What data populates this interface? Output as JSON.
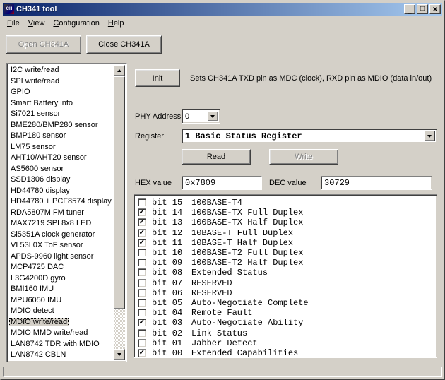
{
  "window": {
    "title": "CH341 tool"
  },
  "icons": {
    "app": "CH",
    "minimize": "_",
    "maximize": "□",
    "close": "×",
    "check": "✓"
  },
  "menu": {
    "items": [
      "File",
      "View",
      "Configuration",
      "Help"
    ]
  },
  "toolbar": {
    "open_button": "Open CH341A",
    "close_button": "Close CH341A"
  },
  "sidebar": {
    "items": [
      "I2C write/read",
      "SPI write/read",
      "GPIO",
      "Smart Battery info",
      "Si7021 sensor",
      "BME280/BMP280 sensor",
      "BMP180 sensor",
      "LM75 sensor",
      "AHT10/AHT20 sensor",
      "AS5600 sensor",
      "SSD1306 display",
      "HD44780 display",
      "HD44780 + PCF8574 display",
      "RDA5807M FM tuner",
      "MAX7219 SPI 8x8 LED",
      "Si5351A clock generator",
      "VL53L0X ToF sensor",
      "APDS-9960 light sensor",
      "MCP4725 DAC",
      "L3G4200D gyro",
      "BMI160 IMU",
      "MPU6050 IMU",
      "MDIO detect",
      "MDIO write/read",
      "MDIO MMD write/read",
      "LAN8742 TDR with MDIO",
      "LAN8742 CBLN"
    ],
    "selected_item": "MDIO write/read"
  },
  "mdio_panel": {
    "init_button": "Init",
    "init_description": "Sets CH341A TXD pin as MDC (clock), RXD pin as MDIO (data in/out)",
    "phy_address_label": "PHY Address",
    "phy_address_value": "0",
    "register_label": "Register",
    "register_value": "1 Basic Status Register",
    "read_button": "Read",
    "write_button": "Write",
    "hex_label": "HEX value",
    "hex_value": "0x7809",
    "dec_label": "DEC value",
    "dec_value": "30729"
  },
  "register_bits": [
    {
      "label": "bit 15",
      "description": "100BASE-T4",
      "checked": false
    },
    {
      "label": "bit 14",
      "description": "100BASE-TX Full Duplex",
      "checked": true
    },
    {
      "label": "bit 13",
      "description": "100BASE-TX Half Duplex",
      "checked": true
    },
    {
      "label": "bit 12",
      "description": "10BASE-T Full Duplex",
      "checked": true
    },
    {
      "label": "bit 11",
      "description": "10BASE-T Half Duplex",
      "checked": true
    },
    {
      "label": "bit 10",
      "description": "100BASE-T2 Full Duplex",
      "checked": false
    },
    {
      "label": "bit 09",
      "description": "100BASE-T2 Half Duplex",
      "checked": false
    },
    {
      "label": "bit 08",
      "description": "Extended Status",
      "checked": false
    },
    {
      "label": "bit 07",
      "description": "RESERVED",
      "checked": false
    },
    {
      "label": "bit 06",
      "description": "RESERVED",
      "checked": false
    },
    {
      "label": "bit 05",
      "description": "Auto-Negotiate Complete",
      "checked": false
    },
    {
      "label": "bit 04",
      "description": "Remote Fault",
      "checked": false
    },
    {
      "label": "bit 03",
      "description": "Auto-Negotiate Ability",
      "checked": true
    },
    {
      "label": "bit 02",
      "description": "Link Status",
      "checked": false
    },
    {
      "label": "bit 01",
      "description": "Jabber Detect",
      "checked": false
    },
    {
      "label": "bit 00",
      "description": "Extended Capabilities",
      "checked": true
    }
  ],
  "colors": {
    "titlebar_gradient_start": "#0a246a",
    "titlebar_gradient_end": "#a6caf0",
    "window_background": "#d4d0c8",
    "disabled_text": "#808080"
  }
}
